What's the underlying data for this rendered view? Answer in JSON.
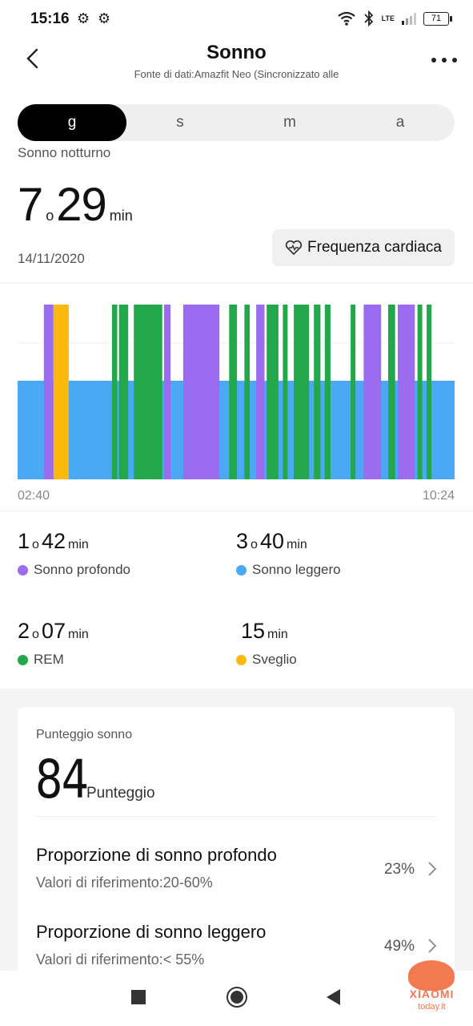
{
  "status_bar": {
    "time": "15:16",
    "net": "LTE",
    "battery": "71",
    "icons": [
      "gear-icon",
      "gear-icon",
      "wifi-icon",
      "bluetooth-icon",
      "signal-icon",
      "battery-icon"
    ]
  },
  "header": {
    "title": "Sonno",
    "subtitle": "Fonte di dati:Amazfit Neo (Sincronizzato alle"
  },
  "range_tabs": [
    {
      "label": "g",
      "active": true
    },
    {
      "label": "s",
      "active": false
    },
    {
      "label": "m",
      "active": false
    },
    {
      "label": "a",
      "active": false
    }
  ],
  "summary": {
    "label": "Sonno notturno",
    "hours": "7",
    "hours_unit": "o",
    "minutes": "29",
    "minutes_unit": "min",
    "date": "14/11/2020",
    "heart_button": "Frequenza cardiaca"
  },
  "colors": {
    "deep": "#9b6bf0",
    "light": "#4aa8f5",
    "rem": "#22a84a",
    "awake": "#fbb90c"
  },
  "chart_data": {
    "type": "bar",
    "x_start": "02:40",
    "x_end": "10:24",
    "baseline_stage": "light",
    "segments": [
      {
        "stage": "deep",
        "start": 0.06,
        "end": 0.082
      },
      {
        "stage": "awake",
        "start": 0.082,
        "end": 0.117
      },
      {
        "stage": "rem",
        "start": 0.216,
        "end": 0.228
      },
      {
        "stage": "rem",
        "start": 0.232,
        "end": 0.253
      },
      {
        "stage": "rem",
        "start": 0.266,
        "end": 0.331
      },
      {
        "stage": "deep",
        "start": 0.335,
        "end": 0.35
      },
      {
        "stage": "deep",
        "start": 0.379,
        "end": 0.462
      },
      {
        "stage": "rem",
        "start": 0.484,
        "end": 0.502
      },
      {
        "stage": "rem",
        "start": 0.519,
        "end": 0.531
      },
      {
        "stage": "deep",
        "start": 0.546,
        "end": 0.565
      },
      {
        "stage": "rem",
        "start": 0.57,
        "end": 0.597
      },
      {
        "stage": "rem",
        "start": 0.607,
        "end": 0.618
      },
      {
        "stage": "rem",
        "start": 0.632,
        "end": 0.667
      },
      {
        "stage": "rem",
        "start": 0.678,
        "end": 0.693
      },
      {
        "stage": "rem",
        "start": 0.703,
        "end": 0.716
      },
      {
        "stage": "rem",
        "start": 0.762,
        "end": 0.773
      },
      {
        "stage": "deep",
        "start": 0.792,
        "end": 0.832
      },
      {
        "stage": "rem",
        "start": 0.848,
        "end": 0.864
      },
      {
        "stage": "deep",
        "start": 0.87,
        "end": 0.909
      },
      {
        "stage": "rem",
        "start": 0.915,
        "end": 0.926
      },
      {
        "stage": "rem",
        "start": 0.936,
        "end": 0.947
      }
    ]
  },
  "stats": [
    {
      "h": "1",
      "h_unit": "o",
      "m": "42",
      "m_unit": "min",
      "label": "Sonno profondo",
      "color": "#9b6bf0"
    },
    {
      "h": "3",
      "h_unit": "o",
      "m": "40",
      "m_unit": "min",
      "label": "Sonno leggero",
      "color": "#4aa8f5"
    },
    {
      "h": "2",
      "h_unit": "o",
      "m": "07",
      "m_unit": "min",
      "label": "REM",
      "color": "#22a84a"
    },
    {
      "h": "",
      "h_unit": "",
      "m": "15",
      "m_unit": "min",
      "label": "Sveglio",
      "color": "#fbb90c"
    }
  ],
  "score": {
    "title": "Punteggio sonno",
    "value": "84",
    "unit": "Punteggio",
    "rows": [
      {
        "title": "Proporzione di sonno profondo",
        "sub": "Valori di riferimento:20-60%",
        "pct": "23%"
      },
      {
        "title": "Proporzione di sonno leggero",
        "sub": "Valori di riferimento:< 55%",
        "pct": "49%"
      }
    ]
  },
  "watermark": {
    "brand": "XIAOMI",
    "site": "today.it"
  }
}
